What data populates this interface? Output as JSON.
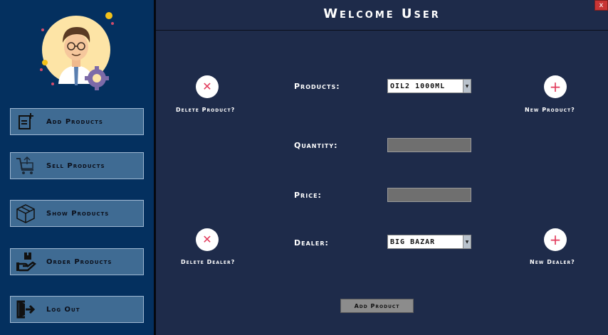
{
  "window": {
    "title": "Welcome User",
    "close_label": "x"
  },
  "sidebar": {
    "items": [
      {
        "label": "Add Products",
        "icon": "add-document-icon"
      },
      {
        "label": "Sell Products",
        "icon": "cart-icon"
      },
      {
        "label": "Show Products",
        "icon": "box-icon"
      },
      {
        "label": "Order Products",
        "icon": "hand-box-icon"
      },
      {
        "label": "Log Out",
        "icon": "logout-icon"
      }
    ]
  },
  "form": {
    "products": {
      "label": "Products:",
      "value": "OIL2 1000ML"
    },
    "quantity": {
      "label": "Quantity:",
      "value": ""
    },
    "price": {
      "label": "Price:",
      "value": ""
    },
    "dealer": {
      "label": "Dealer:",
      "value": "BIG BAZAR"
    }
  },
  "actions": {
    "delete_product": "Delete Product?",
    "new_product": "New Product?",
    "delete_dealer": "Delete Dealer?",
    "new_dealer": "New Dealer?",
    "add_product": "Add Product"
  },
  "colors": {
    "sidebar_bg": "#04305f",
    "main_bg": "#1e2b4a",
    "accent_red": "#e23a5b",
    "nav_btn": "#3f6b93"
  }
}
